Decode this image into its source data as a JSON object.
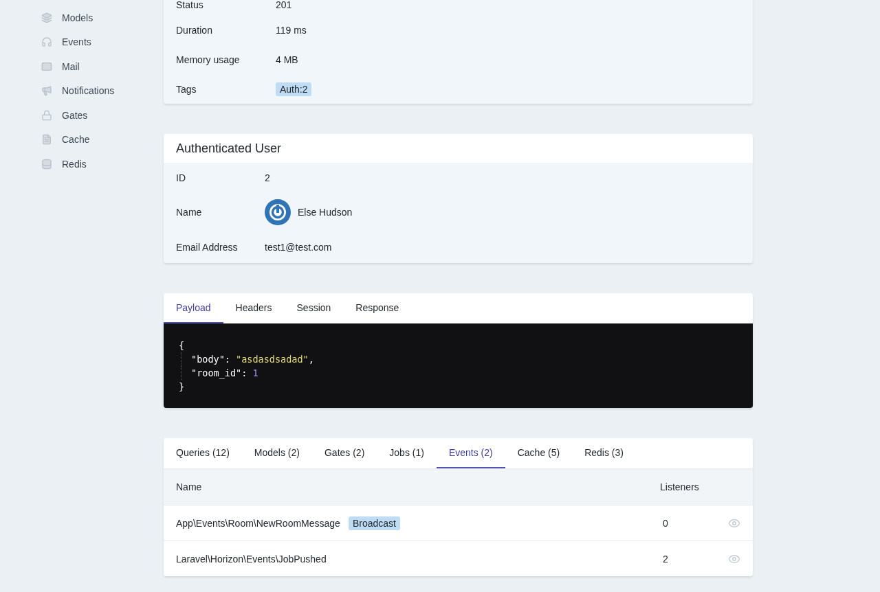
{
  "sidebar": {
    "items": [
      {
        "label": "Models"
      },
      {
        "label": "Events"
      },
      {
        "label": "Mail"
      },
      {
        "label": "Notifications"
      },
      {
        "label": "Gates"
      },
      {
        "label": "Cache"
      },
      {
        "label": "Redis"
      }
    ]
  },
  "request_details": {
    "rows": [
      {
        "label": "Status",
        "value": "201"
      },
      {
        "label": "Duration",
        "value": "119 ms"
      },
      {
        "label": "Memory usage",
        "value": "4 MB"
      },
      {
        "label": "Tags",
        "tags": [
          "Auth:2"
        ]
      }
    ]
  },
  "authenticated_user": {
    "title": "Authenticated User",
    "rows": [
      {
        "kind": "text",
        "label": "ID",
        "value": "2"
      },
      {
        "kind": "person",
        "label": "Name",
        "value": "Else Hudson"
      },
      {
        "kind": "text",
        "label": "Email Address",
        "value": "test1@test.com"
      }
    ]
  },
  "payload_panel": {
    "tabs": [
      {
        "label": "Payload",
        "selected": true
      },
      {
        "label": "Headers",
        "selected": false
      },
      {
        "label": "Session",
        "selected": false
      },
      {
        "label": "Response",
        "selected": false
      }
    ],
    "code": [
      [
        {
          "kind": "punct",
          "text": "{"
        }
      ],
      [
        {
          "kind": "key",
          "text": "\"body\""
        },
        {
          "kind": "punct",
          "text": ": "
        },
        {
          "kind": "string",
          "text": "\"asdasdsadad\""
        },
        {
          "kind": "punct",
          "text": ","
        }
      ],
      [
        {
          "kind": "key",
          "text": "\"room_id\""
        },
        {
          "kind": "punct",
          "text": ": "
        },
        {
          "kind": "number",
          "text": "1"
        }
      ],
      [
        {
          "kind": "punct",
          "text": "}"
        }
      ]
    ]
  },
  "related_panel": {
    "tabs": [
      {
        "label": "Queries (12)",
        "selected": false
      },
      {
        "label": "Models (2)",
        "selected": false
      },
      {
        "label": "Gates (2)",
        "selected": false
      },
      {
        "label": "Jobs (1)",
        "selected": false
      },
      {
        "label": "Events (2)",
        "selected": true
      },
      {
        "label": "Cache (5)",
        "selected": false
      },
      {
        "label": "Redis (3)",
        "selected": false
      }
    ],
    "table": {
      "columns": [
        "Name",
        "Listeners"
      ],
      "rows": [
        {
          "name": "App\\Events\\Room\\NewRoomMessage",
          "badge": "Broadcast",
          "listeners": "0"
        },
        {
          "name": "Laravel\\Horizon\\Events\\JobPushed",
          "listeners": "2"
        }
      ]
    }
  }
}
